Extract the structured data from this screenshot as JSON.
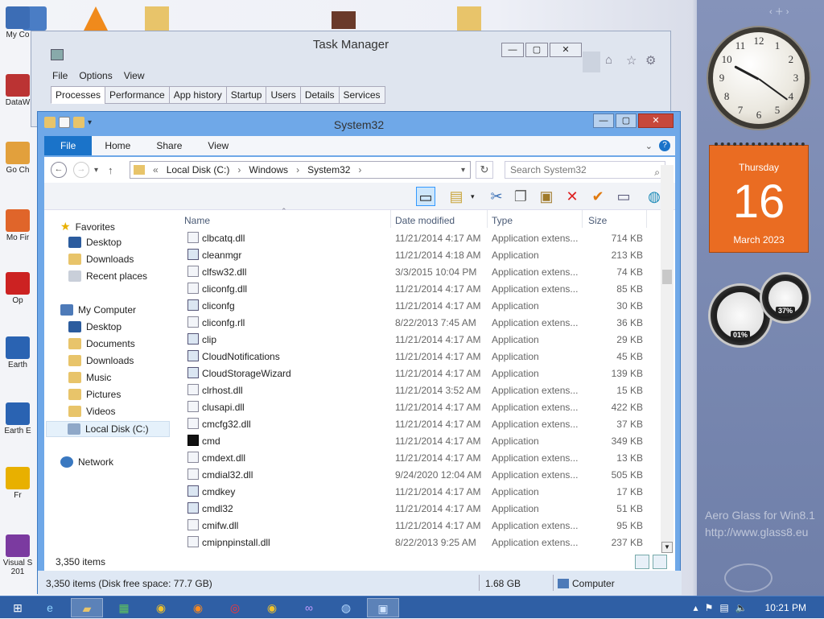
{
  "desktop": {
    "icons": [
      {
        "label": "My Co",
        "color": "#3c6db5"
      },
      {
        "label": "DataW",
        "color": "#b33"
      },
      {
        "label": "Go Ch",
        "color": "#e2a03c"
      },
      {
        "label": "Mo Fir",
        "color": "#e0652a"
      },
      {
        "label": "Op",
        "color": "#c22"
      },
      {
        "label": "Earth",
        "color": "#2a63b2"
      },
      {
        "label": "Earth E",
        "color": "#2a63b2"
      },
      {
        "label": "Fr",
        "color": "#e8b000"
      },
      {
        "label": "Visual S 201",
        "color": "#7b3aa0"
      }
    ]
  },
  "task_manager": {
    "title": "Task Manager",
    "menu": [
      "File",
      "Options",
      "View"
    ],
    "tabs": [
      "Processes",
      "Performance",
      "App history",
      "Startup",
      "Users",
      "Details",
      "Services"
    ],
    "active_tab": "Processes"
  },
  "explorer": {
    "title": "System32",
    "ribbon_tabs": [
      "File",
      "Home",
      "Share",
      "View"
    ],
    "breadcrumb": [
      "Local Disk (C:)",
      "Windows",
      "System32"
    ],
    "search_placeholder": "Search System32",
    "columns": {
      "name": "Name",
      "date": "Date modified",
      "type": "Type",
      "size": "Size"
    },
    "nav": {
      "favorites": "Favorites",
      "favorites_items": [
        "Desktop",
        "Downloads",
        "Recent places"
      ],
      "computer": "My Computer",
      "computer_items": [
        "Desktop",
        "Documents",
        "Downloads",
        "Music",
        "Pictures",
        "Videos",
        "Local Disk (C:)"
      ],
      "selected": "Local Disk (C:)",
      "network": "Network"
    },
    "files": [
      {
        "name": "clbcatq.dll",
        "date": "11/21/2014 4:17 AM",
        "type": "Application extens...",
        "size": "714 KB",
        "icon": "dll"
      },
      {
        "name": "cleanmgr",
        "date": "11/21/2014 4:18 AM",
        "type": "Application",
        "size": "213 KB",
        "icon": "app"
      },
      {
        "name": "clfsw32.dll",
        "date": "3/3/2015 10:04 PM",
        "type": "Application extens...",
        "size": "74 KB",
        "icon": "dll"
      },
      {
        "name": "cliconfg.dll",
        "date": "11/21/2014 4:17 AM",
        "type": "Application extens...",
        "size": "85 KB",
        "icon": "dll"
      },
      {
        "name": "cliconfg",
        "date": "11/21/2014 4:17 AM",
        "type": "Application",
        "size": "30 KB",
        "icon": "app"
      },
      {
        "name": "cliconfg.rll",
        "date": "8/22/2013 7:45 AM",
        "type": "Application extens...",
        "size": "36 KB",
        "icon": "dll"
      },
      {
        "name": "clip",
        "date": "11/21/2014 4:17 AM",
        "type": "Application",
        "size": "29 KB",
        "icon": "app"
      },
      {
        "name": "CloudNotifications",
        "date": "11/21/2014 4:17 AM",
        "type": "Application",
        "size": "45 KB",
        "icon": "app"
      },
      {
        "name": "CloudStorageWizard",
        "date": "11/21/2014 4:17 AM",
        "type": "Application",
        "size": "139 KB",
        "icon": "app"
      },
      {
        "name": "clrhost.dll",
        "date": "11/21/2014 3:52 AM",
        "type": "Application extens...",
        "size": "15 KB",
        "icon": "dll"
      },
      {
        "name": "clusapi.dll",
        "date": "11/21/2014 4:17 AM",
        "type": "Application extens...",
        "size": "422 KB",
        "icon": "dll"
      },
      {
        "name": "cmcfg32.dll",
        "date": "11/21/2014 4:17 AM",
        "type": "Application extens...",
        "size": "37 KB",
        "icon": "dll"
      },
      {
        "name": "cmd",
        "date": "11/21/2014 4:17 AM",
        "type": "Application",
        "size": "349 KB",
        "icon": "cmd"
      },
      {
        "name": "cmdext.dll",
        "date": "11/21/2014 4:17 AM",
        "type": "Application extens...",
        "size": "13 KB",
        "icon": "dll"
      },
      {
        "name": "cmdial32.dll",
        "date": "9/24/2020 12:04 AM",
        "type": "Application extens...",
        "size": "505 KB",
        "icon": "dll"
      },
      {
        "name": "cmdkey",
        "date": "11/21/2014 4:17 AM",
        "type": "Application",
        "size": "17 KB",
        "icon": "app"
      },
      {
        "name": "cmdl32",
        "date": "11/21/2014 4:17 AM",
        "type": "Application",
        "size": "51 KB",
        "icon": "app"
      },
      {
        "name": "cmifw.dll",
        "date": "11/21/2014 4:17 AM",
        "type": "Application extens...",
        "size": "95 KB",
        "icon": "dll"
      },
      {
        "name": "cmipnpinstall.dll",
        "date": "8/22/2013 9:25 AM",
        "type": "Application extens...",
        "size": "237 KB",
        "icon": "dll"
      }
    ],
    "item_count": "3,350 items",
    "status_items": "3,350 items (Disk free space: 77.7 GB)",
    "status_size": "1.68 GB",
    "status_location": "Computer"
  },
  "gadgets": {
    "calendar": {
      "weekday": "Thursday",
      "day": "16",
      "month_year": "March 2023"
    },
    "clock_numbers": [
      "12",
      "1",
      "2",
      "3",
      "4",
      "5",
      "6",
      "7",
      "8",
      "9",
      "10",
      "11"
    ],
    "cpu_meter": "01%",
    "mem_meter": "37%"
  },
  "watermark": {
    "line1": "Aero Glass for Win8.1",
    "line2": "http://www.glass8.eu"
  },
  "taskbar": {
    "time": "10:21 PM"
  },
  "colors": {
    "accent": "#1a73c9",
    "calendar": "#ea6c22",
    "taskbar": "#2f5fa5"
  }
}
